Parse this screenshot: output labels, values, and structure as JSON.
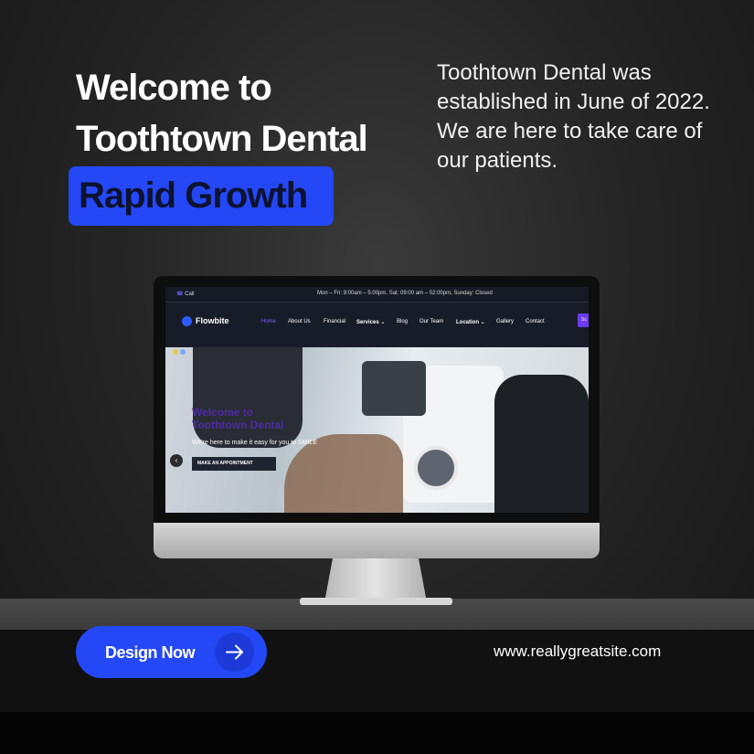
{
  "headline": {
    "line1": "Welcome to",
    "line2": "Toothtown Dental",
    "highlight": "Rapid Growth"
  },
  "intro": "Toothtown Dental was established in June of 2022. We are here to take care of our patients.",
  "website": {
    "topbar": {
      "call": "Call",
      "hours": "Mon – Fri: 9:00am – 5:00pm, Sat: 09:00 am – 02:00pm, Sunday: Closed"
    },
    "logo": "Flowbite",
    "nav": [
      {
        "label": "Home",
        "active": true
      },
      {
        "label": "About Us"
      },
      {
        "label": "Financial"
      },
      {
        "label": "Services ⌄"
      },
      {
        "label": "Blog"
      },
      {
        "label": "Our Team"
      },
      {
        "label": "Location ⌄"
      },
      {
        "label": "Gallery"
      },
      {
        "label": "Contact"
      }
    ],
    "cta_fragment": "Sc",
    "hero": {
      "title_line1": "Welcome to",
      "title_line2": "Toothtown Dental",
      "subtitle": "We're here to make it easy for you to SMILE",
      "button": "MAKE AN APPOINTMENT",
      "prev_icon": "chevron-left-icon"
    }
  },
  "cta": {
    "label": "Design Now",
    "icon": "arrow-right-icon"
  },
  "url": "www.reallygreatsite.com",
  "colors": {
    "accent": "#2448f5",
    "background": "#262626",
    "hero_title": "#4d2aa8"
  }
}
